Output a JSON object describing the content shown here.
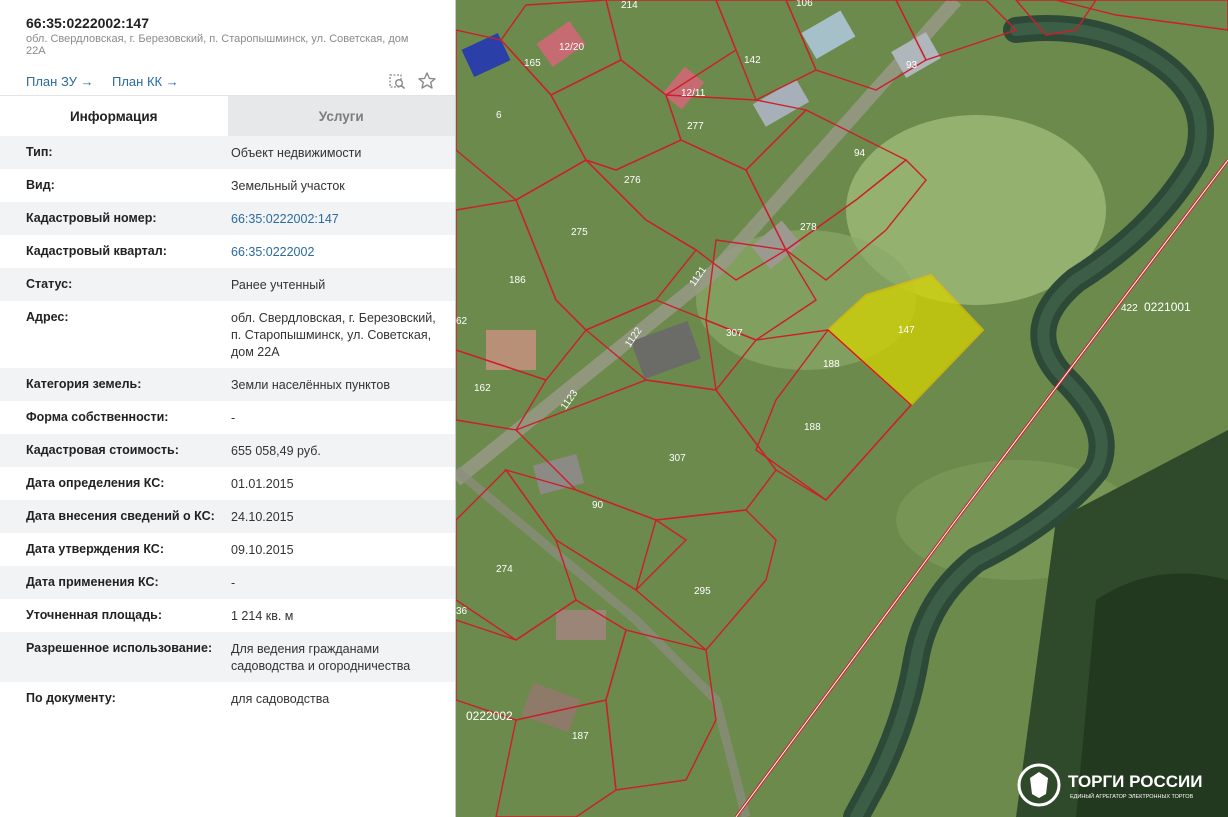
{
  "header": {
    "cadastral_number": "66:35:0222002:147",
    "address": "обл. Свердловская, г. Березовский, п. Старопышминск, ул. Советская, дом 22А"
  },
  "links": {
    "plan_zu": "План ЗУ",
    "plan_kk": "План КК",
    "arrow": "→"
  },
  "tabs": {
    "info": "Информация",
    "services": "Услуги"
  },
  "rows": [
    {
      "k": "Тип:",
      "v": "Объект недвижимости"
    },
    {
      "k": "Вид:",
      "v": "Земельный участок"
    },
    {
      "k": "Кадастровый номер:",
      "v": "66:35:0222002:147"
    },
    {
      "k": "Кадастровый квартал:",
      "v": "66:35:0222002"
    },
    {
      "k": "Статус:",
      "v": "Ранее учтенный"
    },
    {
      "k": "Адрес:",
      "v": "обл. Свердловская, г. Березовский, п. Старопышминск, ул. Советская, дом 22А"
    },
    {
      "k": "Категория земель:",
      "v": "Земли населённых пунктов"
    },
    {
      "k": "Форма собственности:",
      "v": "-"
    },
    {
      "k": "Кадастровая стоимость:",
      "v": "655 058,49 руб."
    },
    {
      "k": "Дата определения КС:",
      "v": "01.01.2015"
    },
    {
      "k": "Дата внесения сведений о КС:",
      "v": "24.10.2015"
    },
    {
      "k": "Дата утверждения КС:",
      "v": "09.10.2015"
    },
    {
      "k": "Дата применения КС:",
      "v": "-"
    },
    {
      "k": "Уточненная площадь:",
      "v": "1 214 кв. м"
    },
    {
      "k": "Разрешенное использование:",
      "v": "Для ведения гражданами садоводства и огородничества"
    },
    {
      "k": "По документу:",
      "v": "для садоводства"
    }
  ],
  "map": {
    "labels": [
      "214",
      "106",
      "165",
      "12/20",
      "142",
      "93",
      "6",
      "12/11",
      "277",
      "94",
      "276",
      "275",
      "278",
      "186",
      "1121",
      "307",
      "147",
      "422",
      "0221001",
      "62",
      "1122",
      "188",
      "162",
      "1123",
      "307",
      "188",
      "90",
      "274",
      "36",
      "295",
      "0222002",
      "187"
    ],
    "selected_color": "#d6d400"
  },
  "brand": {
    "name": "ТОРГИ РОССИИ",
    "tagline": "ЕДИНЫЙ АГРЕГАТОР ЭЛЕКТРОННЫХ ТОРГОВ"
  }
}
